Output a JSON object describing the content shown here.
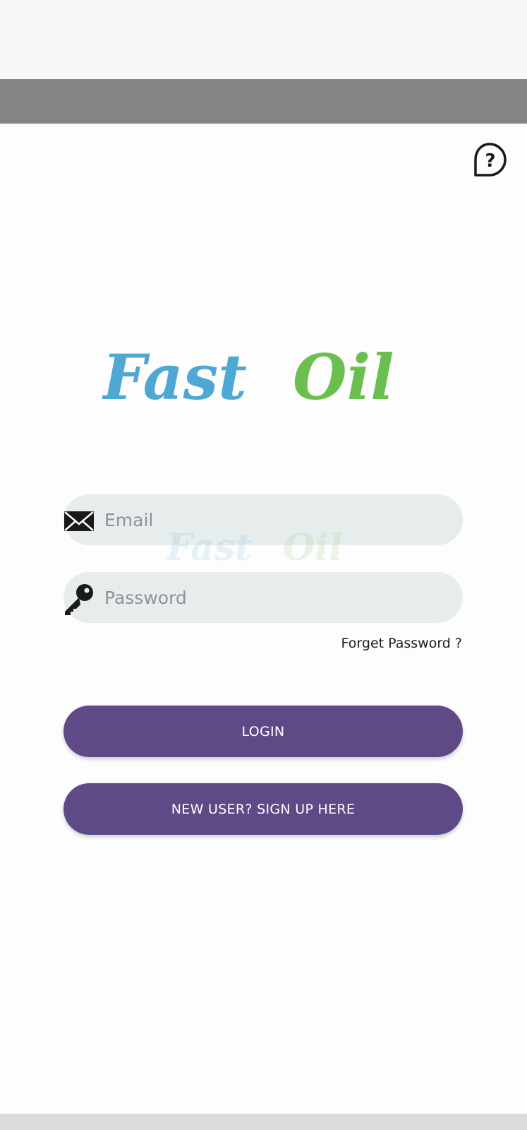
{
  "logo": {
    "part1": "Fast",
    "part2": "Oil",
    "color1": "#4fa7d3",
    "color2": "#6bbf4e"
  },
  "form": {
    "email_placeholder": "Email",
    "password_placeholder": "Password",
    "forget_label": "Forget Password ?"
  },
  "buttons": {
    "login_label": "LOGIN",
    "signup_label": "NEW USER? SIGN UP HERE"
  },
  "colors": {
    "accent": "#5d4a87",
    "field_bg": "#e7eced"
  },
  "icons": {
    "help": "help-bubble-icon",
    "email": "envelope-icon",
    "password": "key-icon"
  }
}
